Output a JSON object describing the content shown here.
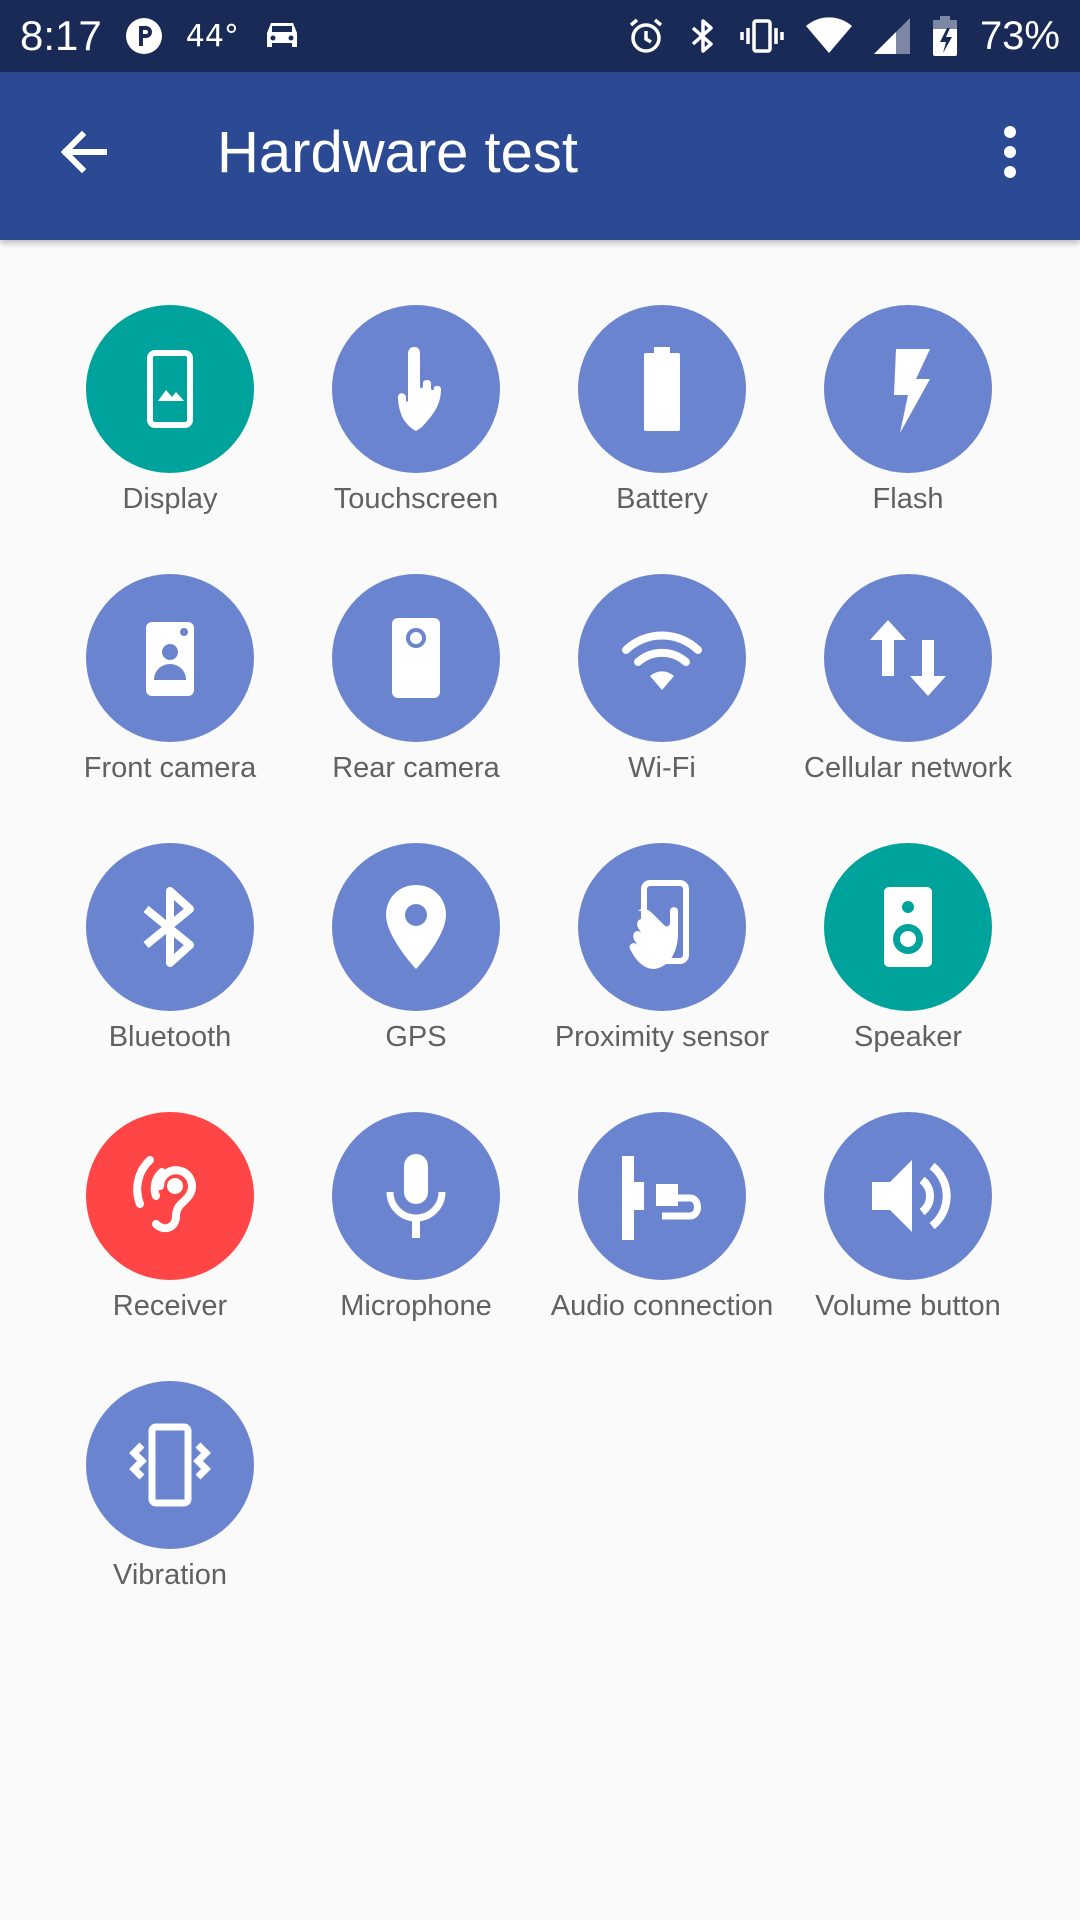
{
  "status_bar": {
    "time": "8:17",
    "temperature": "44°",
    "battery": "73%"
  },
  "app_bar": {
    "title": "Hardware test"
  },
  "colors": {
    "default": "#6b84cf",
    "passed": "#00a39b",
    "failed": "#ff4545"
  },
  "tests": [
    {
      "label": "Display",
      "icon": "display-icon",
      "status": "passed"
    },
    {
      "label": "Touchscreen",
      "icon": "touchscreen-icon",
      "status": "default"
    },
    {
      "label": "Battery",
      "icon": "battery-icon",
      "status": "default"
    },
    {
      "label": "Flash",
      "icon": "flash-icon",
      "status": "default"
    },
    {
      "label": "Front camera",
      "icon": "front-camera-icon",
      "status": "default"
    },
    {
      "label": "Rear camera",
      "icon": "rear-camera-icon",
      "status": "default"
    },
    {
      "label": "Wi-Fi",
      "icon": "wifi-icon",
      "status": "default"
    },
    {
      "label": "Cellular network",
      "icon": "cellular-network-icon",
      "status": "default"
    },
    {
      "label": "Bluetooth",
      "icon": "bluetooth-icon",
      "status": "default"
    },
    {
      "label": "GPS",
      "icon": "gps-icon",
      "status": "default"
    },
    {
      "label": "Proximity sensor",
      "icon": "proximity-sensor-icon",
      "status": "default"
    },
    {
      "label": "Speaker",
      "icon": "speaker-icon",
      "status": "passed"
    },
    {
      "label": "Receiver",
      "icon": "receiver-icon",
      "status": "failed"
    },
    {
      "label": "Microphone",
      "icon": "microphone-icon",
      "status": "default"
    },
    {
      "label": "Audio connection",
      "icon": "audio-connection-icon",
      "status": "default"
    },
    {
      "label": "Volume button",
      "icon": "volume-button-icon",
      "status": "default"
    },
    {
      "label": "Vibration",
      "icon": "vibration-icon",
      "status": "default"
    }
  ]
}
